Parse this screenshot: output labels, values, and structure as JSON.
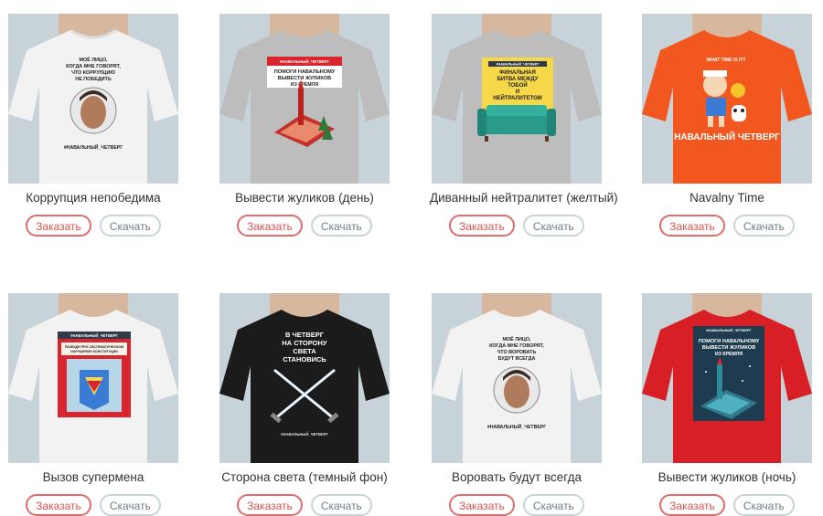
{
  "buttons": {
    "order": "Заказать",
    "download": "Скачать"
  },
  "products": [
    {
      "title": "Коррупция непобедима",
      "shirt": "#f2f2f2",
      "print": [
        "МОЁ ЛИЦО,",
        "КОГДА МНЕ ГОВОРЯТ,",
        "ЧТО КОРРУПЦИЮ",
        "НЕ ПОБЕДИТЬ"
      ],
      "tag": "#НАВАЛЬНЫЙ_ЧЕТВЕРГ"
    },
    {
      "title": "Вывести жуликов (день)",
      "shirt": "#bdbdbd",
      "print": [
        "ПОМОГИ НАВАЛЬНОМУ",
        "ВЫВЕСТИ ЖУЛИКОВ",
        "ИЗ КРЕМЛЯ"
      ],
      "tag": "#НАВАЛЬНЫЙ_ЧЕТВЕРГ"
    },
    {
      "title": "Диванный нейтралитет (желтый)",
      "shirt": "#bdbdbd",
      "print": [
        "ФИНАЛЬНАЯ",
        "БИТВА МЕЖДУ",
        "ТОБОЙ",
        "И",
        "НЕЙТРАЛИТЕТОМ"
      ],
      "tag": "#НАВАЛЬНЫЙ_ЧЕТВЕРГ"
    },
    {
      "title": "Navalny Time",
      "shirt": "#f2571f",
      "print": [
        "WHAT TIME IS IT?"
      ],
      "tag": "НАВАЛЬНЫЙ ЧЕТВЕРГ"
    },
    {
      "title": "Вызов супермена",
      "shirt": "#f2f2f2",
      "print": [
        "РАЗБУДИ ПРИ СИСТЕМАТИЧЕСКОМ",
        "НАРУШЕНИИ КОНСТИТУЦИИ"
      ],
      "tag": "#НАВАЛЬНЫЙ_ЧЕТВЕРГ"
    },
    {
      "title": "Сторона света (темный фон)",
      "shirt": "#1b1b1b",
      "print": [
        "В ЧЕТВЕРГ",
        "НА СТОРОНУ",
        "СВЕТА",
        "СТАНОВИСЬ"
      ],
      "tag": "#НАВАЛЬНЫЙ_ЧЕТВЕРГ"
    },
    {
      "title": "Воровать будут всегда",
      "shirt": "#f2f2f2",
      "print": [
        "МОЁ ЛИЦО,",
        "КОГДА МНЕ ГОВОРЯТ,",
        "ЧТО ВОРОВАТЬ",
        "БУДУТ ВСЕГДА"
      ],
      "tag": "#НАВАЛЬНЫЙ_ЧЕТВЕРГ"
    },
    {
      "title": "Вывести жуликов (ночь)",
      "shirt": "#d81f26",
      "print": [
        "ПОМОГИ НАВАЛЬНОМУ",
        "ВЫВЕСТИ ЖУЛИКОВ",
        "ИЗ КРЕМЛЯ"
      ],
      "tag": "#НАВАЛЬНЫЙ_ЧЕТВЕРГ"
    }
  ]
}
